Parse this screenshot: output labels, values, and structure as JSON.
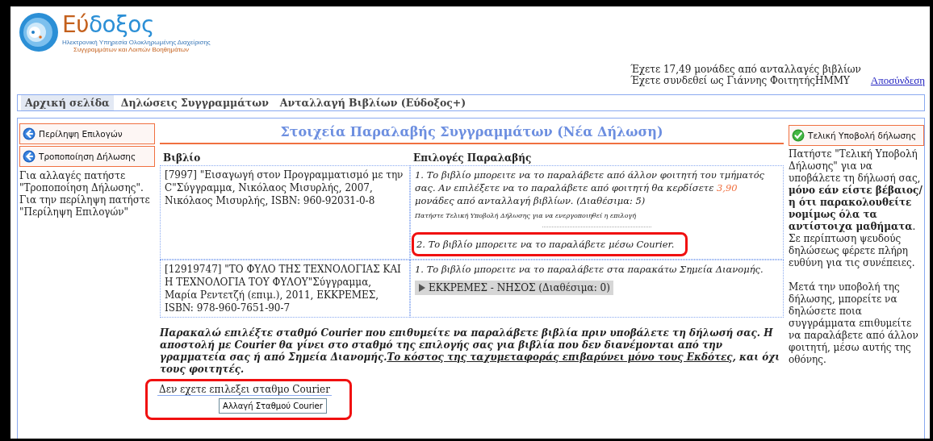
{
  "logo": {
    "name_part_1": "Εύ",
    "name_part_2": "δοξος",
    "tagline_1": "Ηλεκτρονική Υπηρεσία Ολοκληρωμένης Διαχείρισης",
    "tagline_2": "Συγγραμμάτων και Λοιπών Βοηθημάτων"
  },
  "user_info": {
    "credits": "Έχετε 17,49 μονάδες από ανταλλαγές βιβλίων",
    "login": "Έχετε συνδεθεί ως Γιάννης ΦοιτητήςΗΜΜΥ",
    "logout_link": "Αποσύνδεση"
  },
  "nav_tabs": [
    {
      "label": "Αρχική σελίδα",
      "selected": true
    },
    {
      "label": "Δηλώσεις Συγγραμμάτων",
      "selected": false
    },
    {
      "label": "Ανταλλαγή Βιβλίων (Εύδοξος+)",
      "selected": false
    }
  ],
  "left_panel": {
    "buttons": [
      "Περίληψη Επιλογών",
      "Τροποποίηση Δήλωσης"
    ],
    "help_text": "Για αλλαγές πατήστε \"Τροποποίηση Δήλωσης\". Για την περίληψη πατήστε \"Περίληψη Επιλογών\""
  },
  "main": {
    "title": "Στοιχεία Παραλαβής Συγγραμμάτων (Νέα Δήλωση)",
    "columns": [
      "Βιβλίο",
      "Επιλογές Παραλαβής"
    ],
    "rows": [
      {
        "book": "[7997] \"Εισαγωγή στον Προγραμματισμό με την C\"Σύγγραμμα, Νικόλαος Μισυρλής, 2007, Νικόλαος Μισυρλής, ISBN: 960-92031-0-8",
        "options": [
          {
            "kind": "student",
            "text_before": "1. Το βιβλίο μπορειτε να το παραλάβετε από άλλον φοιτητή του τμήματός σας. Αν επιλέξετε να το παραλάβετε από φοιτητή θα κερδίσετε ",
            "points": "3,90",
            "text_after": " μονάδες από ανταλλαγή βιβλίων. (Διαθέσιμα: 5)",
            "note": "Πατήστε Τελική Υποβολή Δήλωσης για να ενεργοποιηθεί η επιλογή",
            "highlighted": false
          },
          {
            "kind": "courier",
            "text": "2. Το βιβλίο μπορειτε να το παραλάβετε μέσω Courier.",
            "highlighted": true
          }
        ]
      },
      {
        "book": "[12919747] \"ΤΟ ΦΥΛΟ ΤΗΣ ΤΕΧΝΟΛΟΓΙΑΣ ΚΑΙ Η ΤΕΧΝΟΛΟΓΙΑ ΤΟΥ ΦΥΛΟΥ\"Σύγγραμμα, Μαρία Ρεντετζή (επιμ.), 2011, ΕΚΚΡΕΜΕΣ, ISBN: 978-960-7651-90-7",
        "options": [
          {
            "kind": "points",
            "text": "1. Το βιβλίο μπορειτε να το παραλάβετε στα παρακάτω Σημεία Διανομής.",
            "locations": [
              {
                "label": "ΕΚΚΡΕΜΕΣ - ΝΗΣΟΣ (Διαθέσιμα: 0)",
                "expanded": false
              }
            ],
            "highlighted": false
          }
        ]
      }
    ],
    "notice": {
      "text": "Παρακαλώ επιλέξτε σταθμό Courier που επιθυμείτε να παραλάβετε βιβλία πριν υποβάλετε τη δήλωσή σας. Η αποστολή με Courier θα γίνει στο σταθμό της επιλογής σας για βιβλία που δεν διανέμονται από την γραμματεία σας ή από Σημεία Διανομής.",
      "underlined": "Το κόστος της ταχυμεταφοράς επιβαρύνει μόνο τους Εκδότες",
      "text_end": ", και όχι τους φοιτητές."
    },
    "courier": {
      "status": "Δεν εχετε επιλεξει σταθμο Courier",
      "button": "Αλλαγή Σταθμού Courier",
      "highlighted": true
    }
  },
  "right_panel": {
    "button": "Τελική Υποβολή δήλωσης",
    "text_1": "Πατήστε \"Τελική Υποβολή Δήλωσης\" για να υποβάλετε τη δήλωσή σας, **μόνο εάν είστε βέβαιος/η ότι παρακολουθείτε νομίμως όλα τα αντίστοιχα μαθήματα**. Σε περίπτωση ψευδούς δηλώσεως φέρετε πλήρη ευθύνη για τις συνέπειες.",
    "text_2": "Μετά την υποβολή της δήλωσης, μπορείτε να δηλώσετε ποια συγγράμματα επιθυμείτε να παραλάβετε από άλλον φοιτητή, μέσω αυτής της οθόνης."
  }
}
